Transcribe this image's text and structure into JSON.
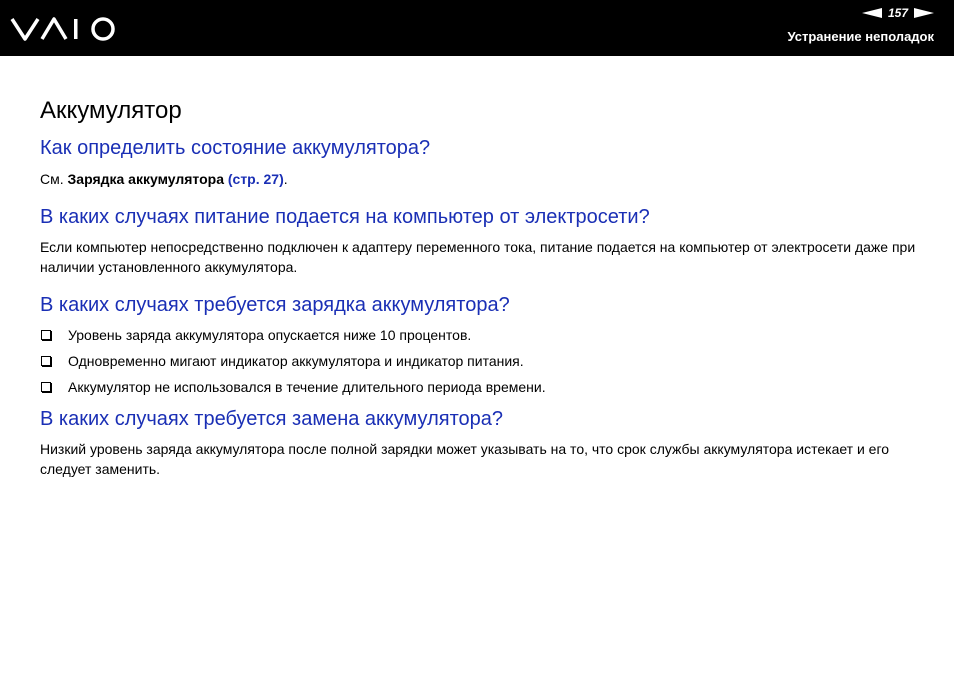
{
  "header": {
    "logo": "VAIO",
    "page_number": "157",
    "section": "Устранение неполадок"
  },
  "main": {
    "title": "Аккумулятор",
    "q1": {
      "heading": "Как определить состояние аккумулятора?",
      "text_prefix": "См. ",
      "bold": "Зарядка аккумулятора",
      "link": "(стр. 27)",
      "suffix": "."
    },
    "q2": {
      "heading": "В каких случаях питание подается на компьютер от электросети?",
      "text": "Если компьютер непосредственно подключен к адаптеру переменного тока, питание подается на компьютер от электросети даже при наличии установленного аккумулятора."
    },
    "q3": {
      "heading": "В каких случаях требуется зарядка аккумулятора?",
      "items": [
        "Уровень заряда аккумулятора опускается ниже 10 процентов.",
        "Одновременно мигают индикатор аккумулятора и индикатор питания.",
        "Аккумулятор не использовался в течение длительного периода времени."
      ]
    },
    "q4": {
      "heading": "В каких случаях требуется замена аккумулятора?",
      "text": "Низкий уровень заряда аккумулятора после полной зарядки может указывать на то, что срок службы аккумулятора истекает и его следует заменить."
    }
  },
  "colors": {
    "heading_blue": "#1a2fb5",
    "header_bg": "#000000"
  }
}
